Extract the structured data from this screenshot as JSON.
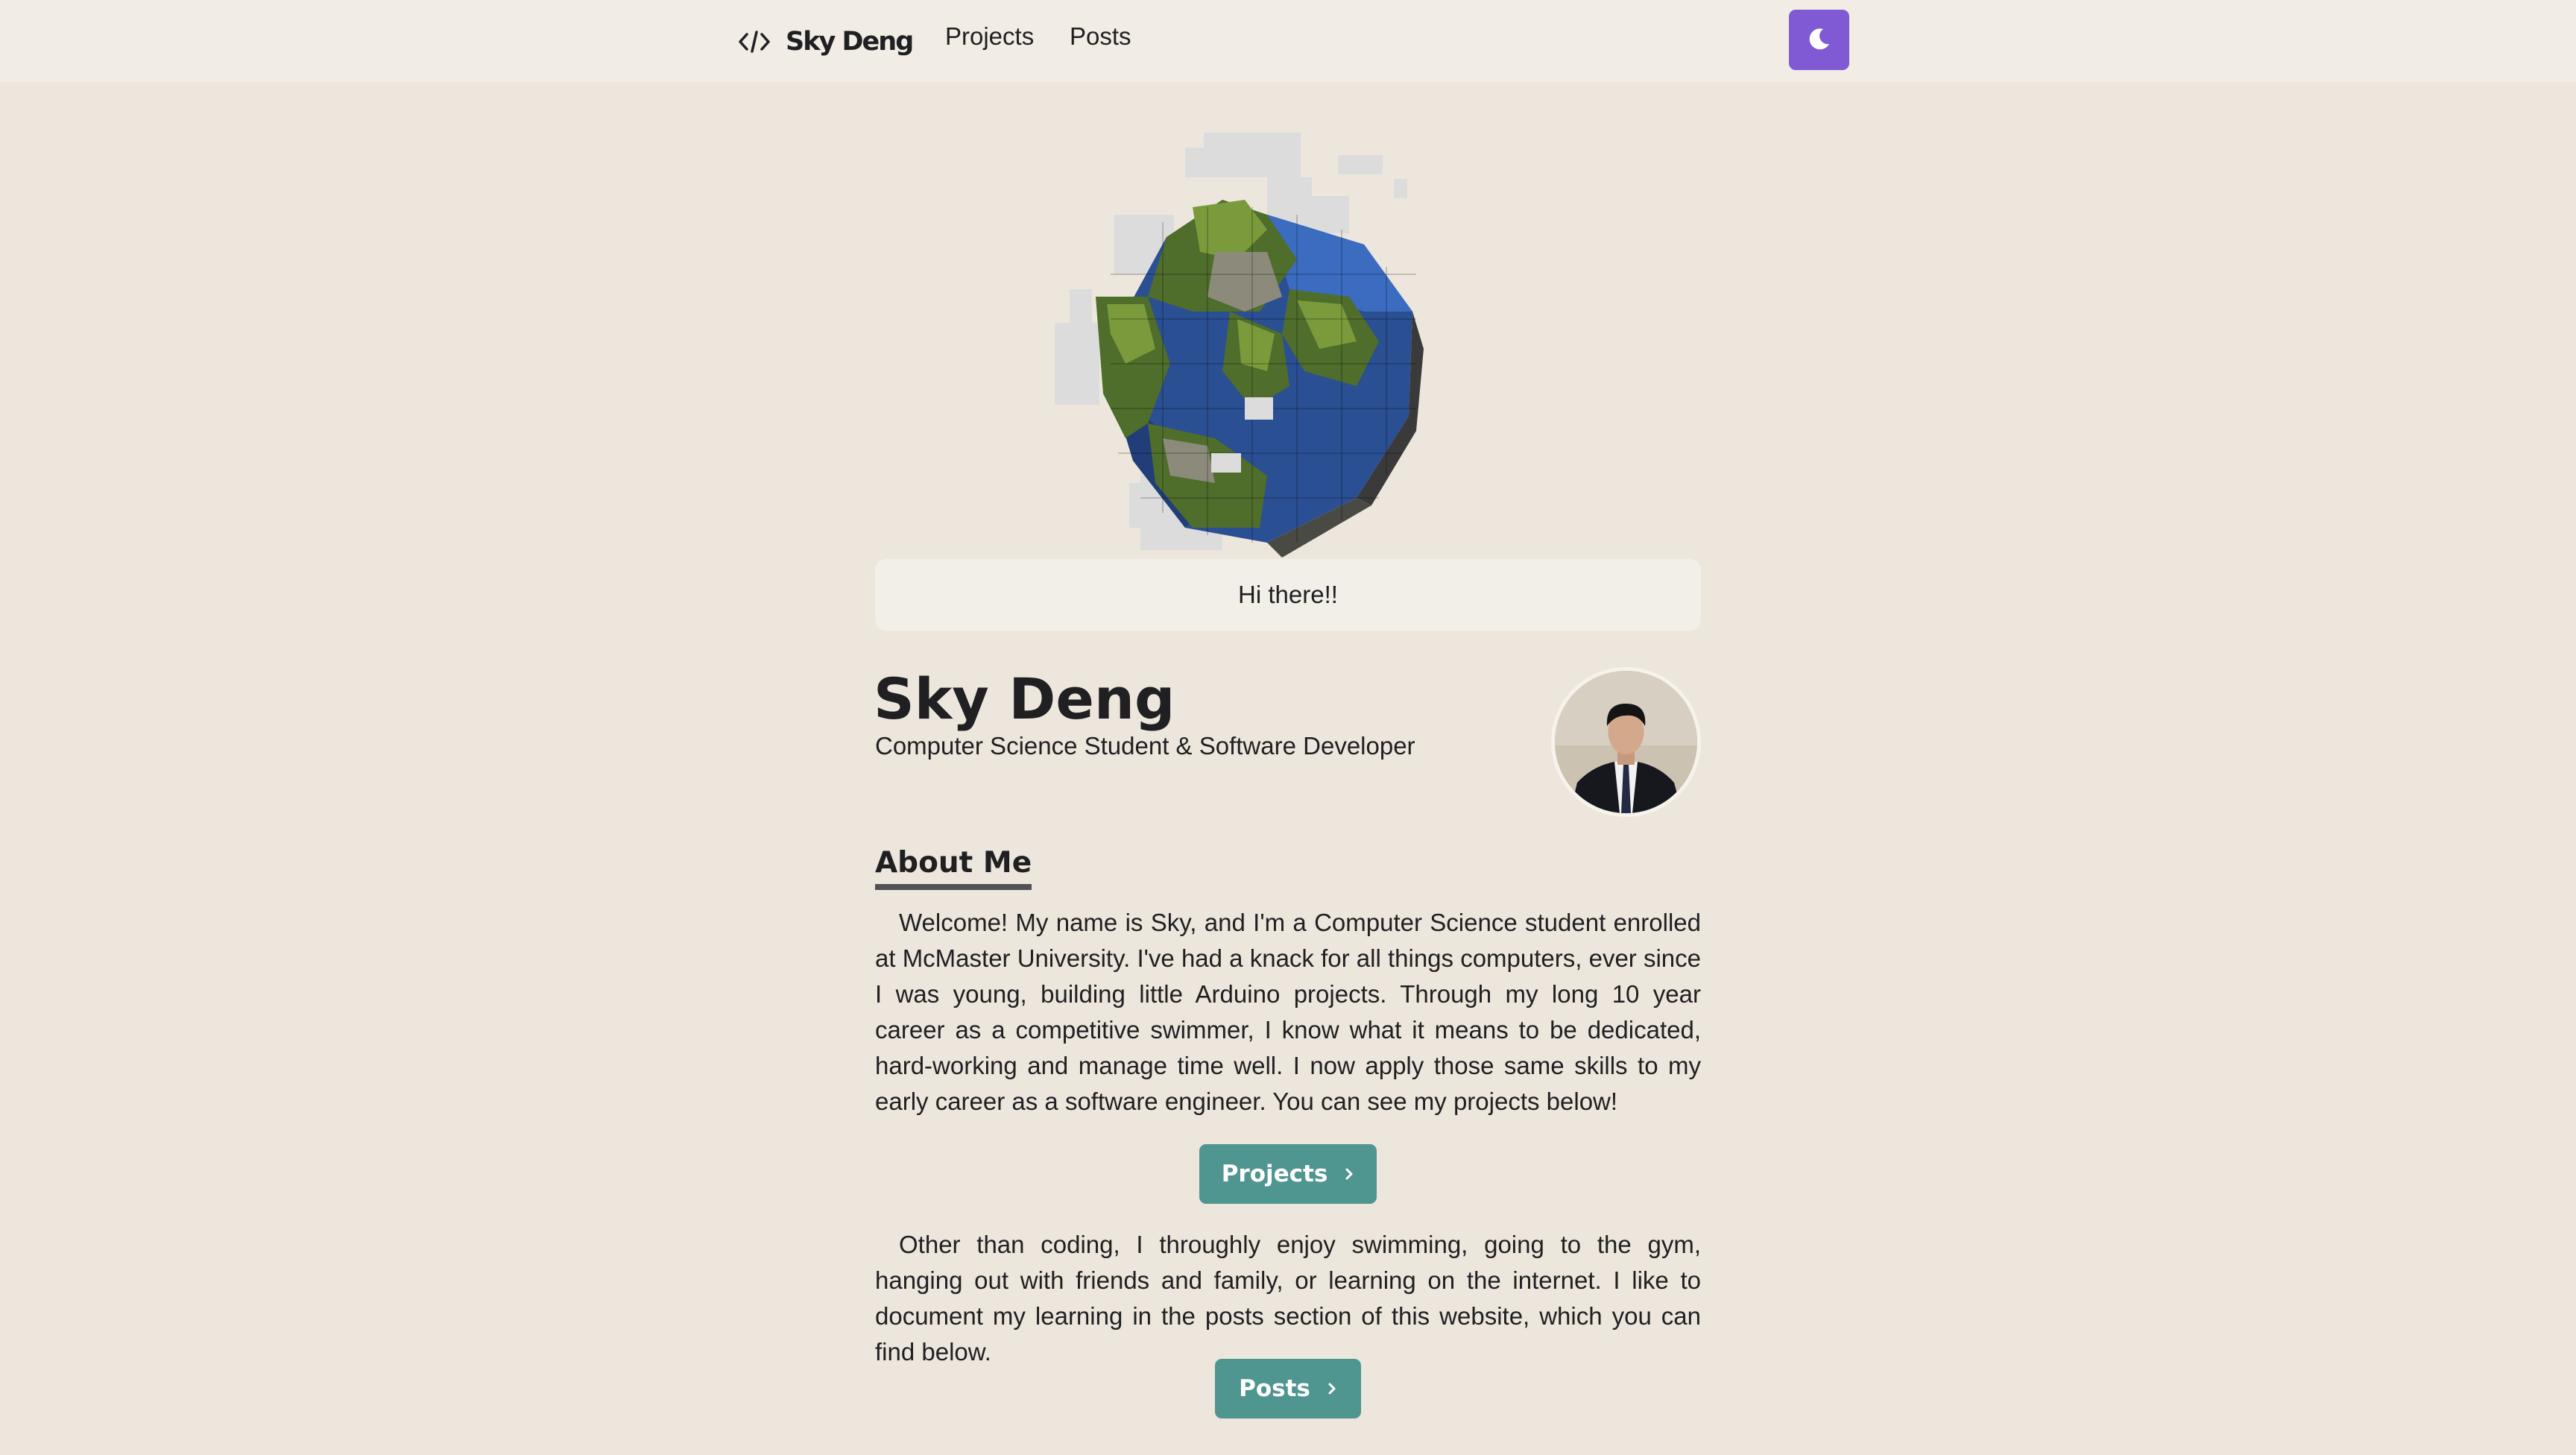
{
  "navbar": {
    "brand_name": "Sky Deng",
    "brand_icon": "code-icon",
    "links": [
      "Projects",
      "Posts"
    ],
    "theme_toggle_icon": "moon-icon"
  },
  "hero": {
    "image": "voxel-earth-globe",
    "greeting": "Hi there!!"
  },
  "profile": {
    "name": "Sky Deng",
    "role": "Computer Science Student & Software Developer",
    "avatar": "profile-photo"
  },
  "about": {
    "heading": "About Me",
    "paragraph_1": "Welcome! My name is Sky, and I'm a Computer Science student enrolled at McMaster University. I've had a knack for all things computers, ever since I was young, building little Arduino projects. Through my long 10 year career as a competitive swimmer, I know what it means to be dedicated, hard-working and manage time well. I now apply those same skills to my early career as a software engineer. You can see my projects below!",
    "projects_button": "Projects",
    "paragraph_2": "Other than coding, I throughly enjoy swimming, going to the gym, hanging out with friends and family, or learning on the internet. I like to document my learning in the posts section of this website, which you can find below.",
    "posts_button": "Posts"
  },
  "colors": {
    "background": "#ede6dc",
    "navbar": "#f1ece4",
    "accent_purple": "#805ad5",
    "button_teal": "#4f9590",
    "text": "#202023"
  }
}
